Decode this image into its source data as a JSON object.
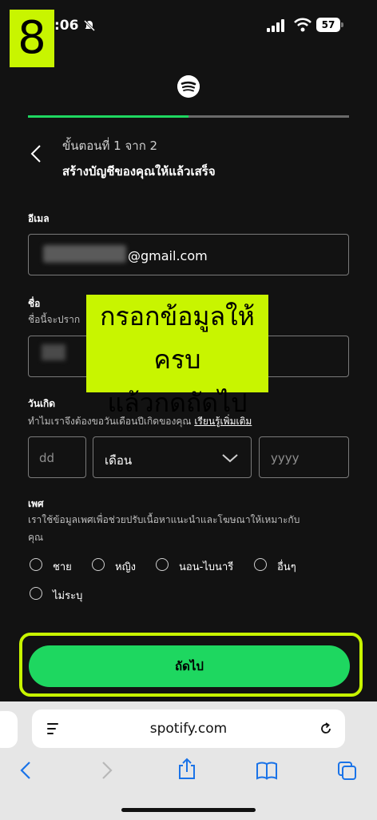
{
  "status": {
    "time": ":06",
    "battery": "57"
  },
  "badge": "8",
  "progress": 0.5,
  "header": {
    "step": "ขั้นตอนที่ 1 จาก 2",
    "title": "สร้างบัญชีของคุณให้แล้วเสร็จ"
  },
  "email": {
    "label": "อีเมล",
    "value": "@gmail.com"
  },
  "name": {
    "label": "ชื่อ",
    "hint": "ชื่อนี้จะปราก"
  },
  "birthday": {
    "label": "วันเกิด",
    "hint": "ทำไมเราจึงต้องขอวันเดือนปีเกิดของคุณ",
    "learn_more": "เรียนรู้เพิ่มเติม",
    "day_placeholder": "dd",
    "month_value": "เดือน",
    "year_placeholder": "yyyy"
  },
  "gender": {
    "label": "เพศ",
    "hint_line1": "เราใช้ข้อมูลเพศเพื่อช่วยปรับเนื้อหาแนะนำและโฆษณาให้เหมาะกับ",
    "hint_line2": "คุณ",
    "options": [
      "ชาย",
      "หญิง",
      "นอน-ไบนารี",
      "อื่นๆ",
      "ไม่ระบุ"
    ]
  },
  "overlay": {
    "line1": "กรอกข้อมูลให้ครบ",
    "line2": "แล้วกดถัดไป"
  },
  "next_button": "ถัดไป",
  "browser": {
    "url": "spotify.com"
  },
  "colors": {
    "accent": "#1ed760",
    "highlight": "#c8f500",
    "background": "#121212"
  }
}
